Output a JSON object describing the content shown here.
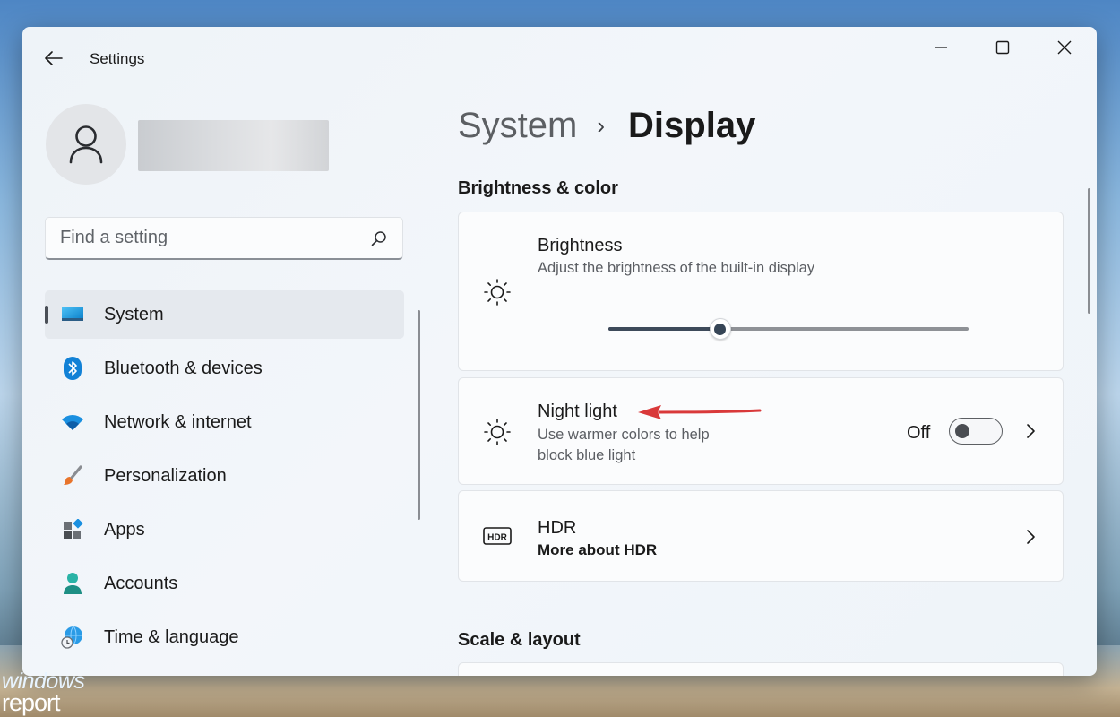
{
  "window": {
    "title": "Settings"
  },
  "sidebar": {
    "search": {
      "placeholder": "Find a setting"
    },
    "items": [
      {
        "label": "System",
        "icon": "monitor-icon",
        "active": true
      },
      {
        "label": "Bluetooth & devices",
        "icon": "bluetooth-icon"
      },
      {
        "label": "Network & internet",
        "icon": "wifi-icon"
      },
      {
        "label": "Personalization",
        "icon": "paintbrush-icon"
      },
      {
        "label": "Apps",
        "icon": "apps-icon"
      },
      {
        "label": "Accounts",
        "icon": "person-icon"
      },
      {
        "label": "Time & language",
        "icon": "globe-clock-icon"
      }
    ]
  },
  "main": {
    "breadcrumb": {
      "parent": "System",
      "separator": "›",
      "current": "Display"
    },
    "sections": {
      "brightness_color": "Brightness & color",
      "scale_layout": "Scale & layout"
    },
    "brightness": {
      "title": "Brightness",
      "subtitle": "Adjust the brightness of the built-in display",
      "icon": "sun-icon",
      "value": 0.31
    },
    "night_light": {
      "title": "Night light",
      "subtitle_line1": "Use warmer colors to help",
      "subtitle_line2": "block blue light",
      "state_label": "Off",
      "enabled": false,
      "icon": "night-light-icon"
    },
    "hdr": {
      "title": "HDR",
      "link": "More about HDR",
      "icon": "hdr-icon"
    }
  },
  "watermark": {
    "line1": "windows",
    "line2": "report"
  },
  "colors": {
    "accent": "#0078d4",
    "annotation_arrow": "#d9393a",
    "text_primary": "#1a1a1a",
    "text_secondary": "#5b5e63"
  }
}
